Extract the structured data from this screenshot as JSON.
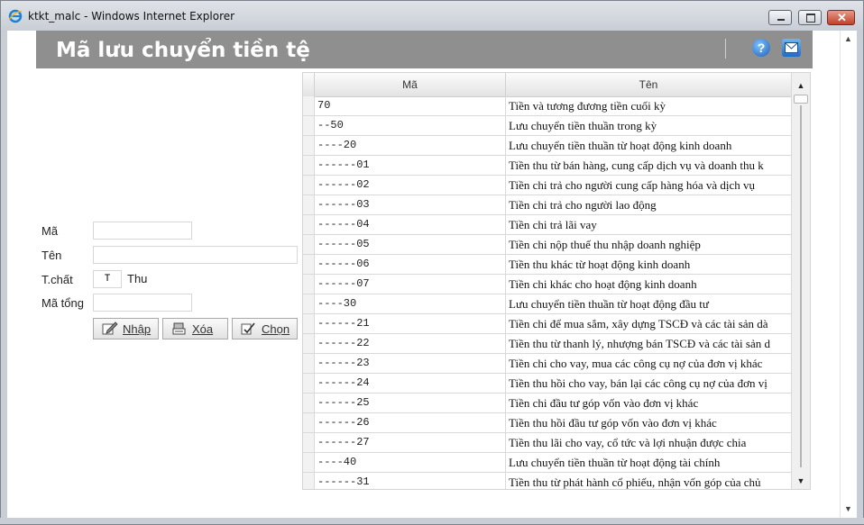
{
  "window": {
    "title": "ktkt_malc - Windows Internet Explorer",
    "icon": "ie-icon"
  },
  "header": {
    "title": "Mã lưu chuyển tiền tệ",
    "help_icon": "help-icon",
    "mail_icon": "mail-icon"
  },
  "form": {
    "ma_label": "Mã",
    "ma_value": "",
    "ten_label": "Tên",
    "ten_value": "",
    "tchat_label": "T.chất",
    "tchat_value": "T",
    "tchat_desc": "Thu",
    "matong_label": "Mã tổng",
    "matong_value": ""
  },
  "buttons": {
    "nhap": "Nhập",
    "xoa": "Xóa",
    "chon": "Chọn"
  },
  "grid": {
    "columns": [
      "Mã",
      "Tên"
    ],
    "rows": [
      {
        "ma": "70",
        "ten": "Tiền và tương đương tiền cuối kỳ"
      },
      {
        "ma": "--50",
        "ten": "Lưu chuyển tiền thuần trong kỳ"
      },
      {
        "ma": "----20",
        "ten": "Lưu chuyển tiền thuần từ hoạt động kinh doanh"
      },
      {
        "ma": "------01",
        "ten": "Tiền thu từ bán hàng, cung cấp dịch vụ và doanh thu k"
      },
      {
        "ma": "------02",
        "ten": "Tiền chi trả cho người cung cấp hàng hóa và dịch vụ"
      },
      {
        "ma": "------03",
        "ten": "Tiền chi trả cho người lao động"
      },
      {
        "ma": "------04",
        "ten": "Tiền chi trả lãi vay"
      },
      {
        "ma": "------05",
        "ten": "Tiền chi nộp thuế thu nhập doanh nghiệp"
      },
      {
        "ma": "------06",
        "ten": "Tiền thu khác từ hoạt động kinh doanh"
      },
      {
        "ma": "------07",
        "ten": "Tiền chi khác cho hoạt động kinh doanh"
      },
      {
        "ma": "----30",
        "ten": "Lưu chuyển tiền thuần từ hoạt động đầu tư"
      },
      {
        "ma": "------21",
        "ten": "Tiền chi để mua sắm, xây dựng TSCĐ và các tài sản dà"
      },
      {
        "ma": "------22",
        "ten": "Tiền thu từ thanh lý, nhượng bán TSCĐ và các tài sản d"
      },
      {
        "ma": "------23",
        "ten": "Tiền chi cho vay, mua các công cụ nợ của đơn vị khác"
      },
      {
        "ma": "------24",
        "ten": "Tiền thu hồi cho vay, bán lại các công cụ nợ của đơn vị"
      },
      {
        "ma": "------25",
        "ten": "Tiền chi đầu tư góp vốn vào đơn vị khác"
      },
      {
        "ma": "------26",
        "ten": "Tiền thu hồi đầu tư góp vốn vào đơn vị khác"
      },
      {
        "ma": "------27",
        "ten": "Tiền thu lãi cho vay, cổ tức và lợi nhuận được chia"
      },
      {
        "ma": "----40",
        "ten": "Lưu chuyển tiền thuần từ hoạt động tài chính"
      },
      {
        "ma": "------31",
        "ten": "Tiền thu từ phát hành cổ phiếu, nhận vốn góp của chủ"
      }
    ]
  }
}
